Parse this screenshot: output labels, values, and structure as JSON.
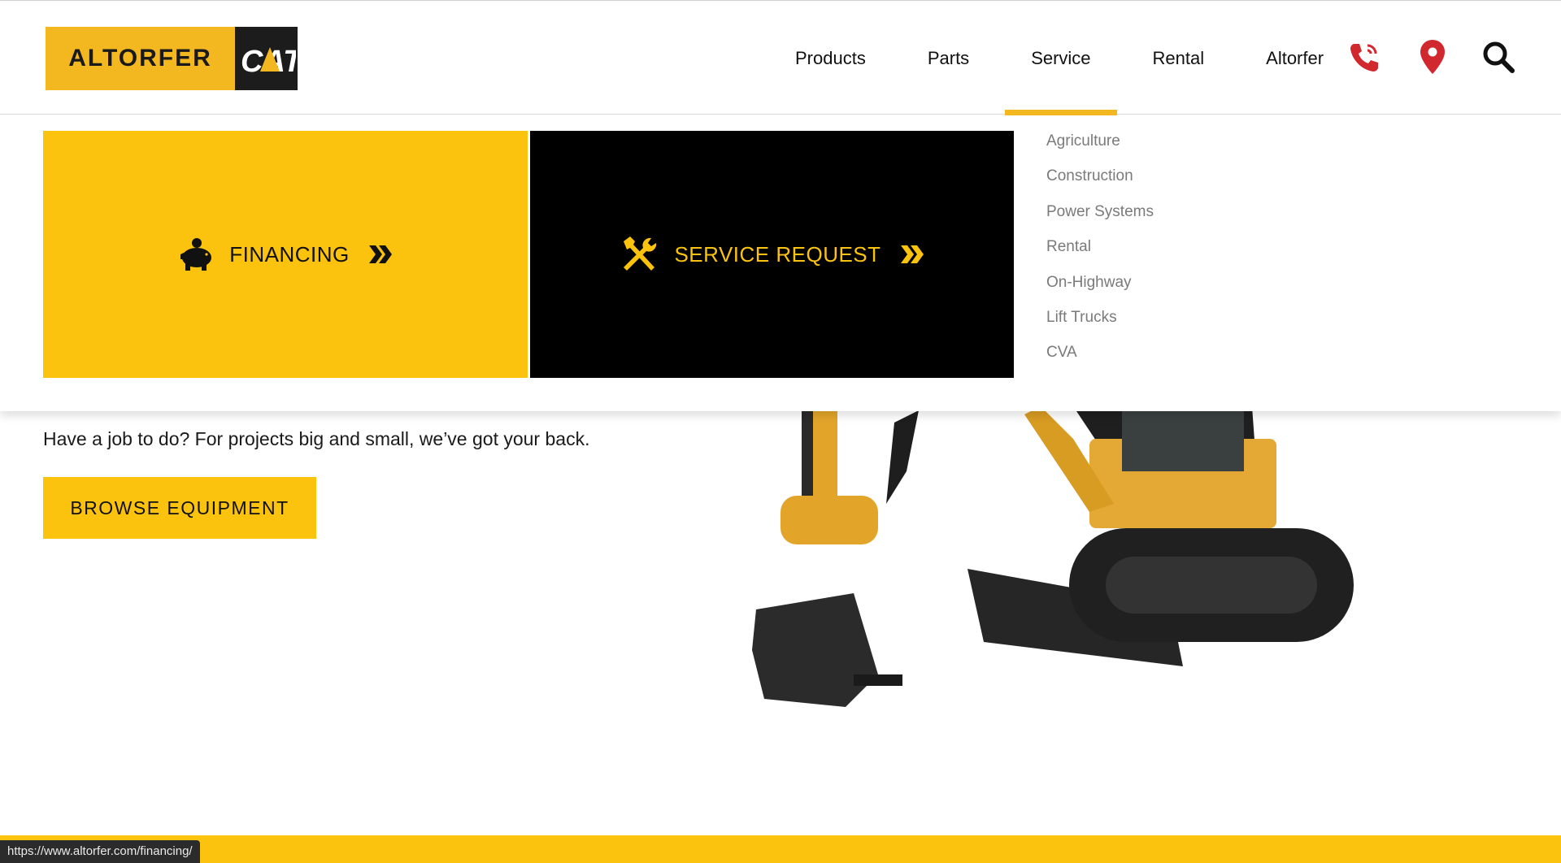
{
  "brand": {
    "name": "ALTORFER",
    "cat_mark": "CAT"
  },
  "nav": {
    "items": [
      {
        "label": "Products"
      },
      {
        "label": "Parts"
      },
      {
        "label": "Service",
        "active": true
      },
      {
        "label": "Rental"
      },
      {
        "label": "Altorfer"
      }
    ],
    "icons": [
      "phone-icon",
      "location-pin-icon",
      "search-icon"
    ]
  },
  "dropdown": {
    "financing_label": "FINANCING",
    "service_request_label": "SERVICE REQUEST",
    "submenu": [
      "Agriculture",
      "Construction",
      "Power Systems",
      "Rental",
      "On-Highway",
      "Lift Trucks",
      "CVA"
    ]
  },
  "hero": {
    "tagline": "Have a job to do? For projects big and small, we’ve got your back.",
    "cta_label": "BROWSE EQUIPMENT"
  },
  "status_url": "https://www.altorfer.com/financing/",
  "colors": {
    "accent_yellow": "#fcc30e",
    "icon_red": "#d0282e",
    "black": "#000000"
  }
}
